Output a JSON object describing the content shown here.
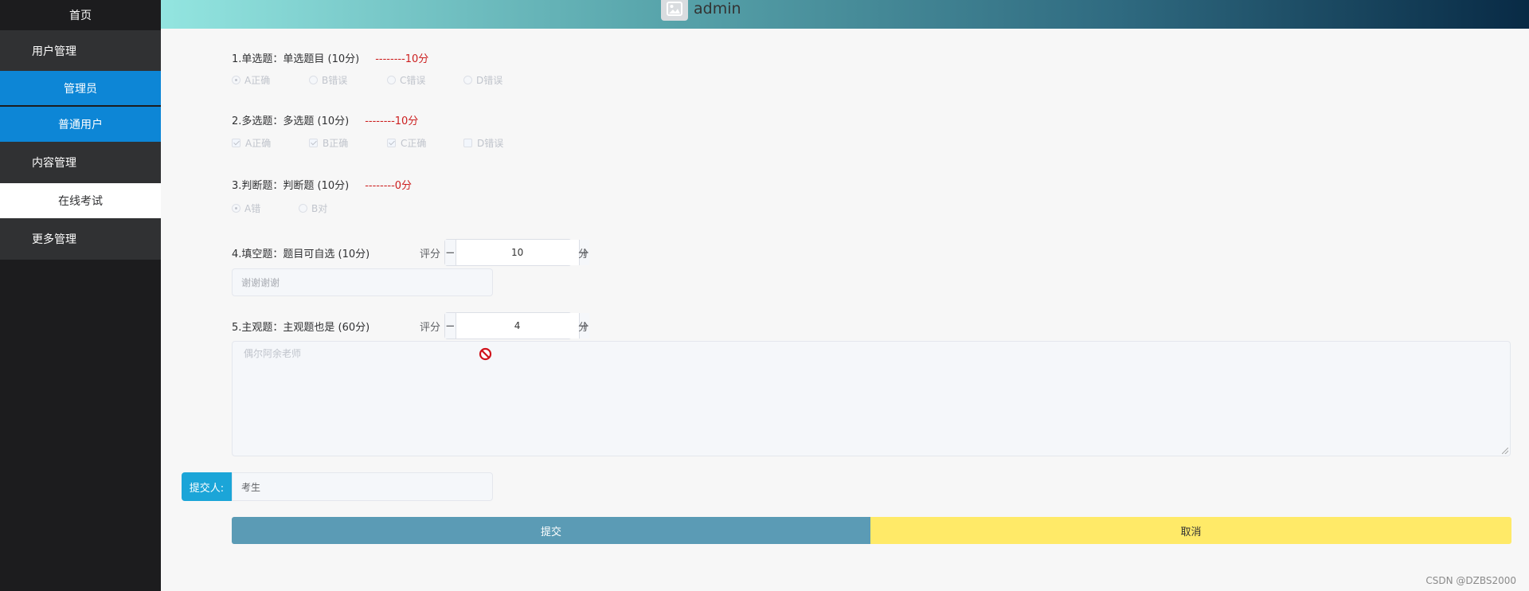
{
  "header": {
    "username": "admin"
  },
  "sidebar": {
    "home": "首页",
    "user_mgmt": "用户管理",
    "admin": "管理员",
    "normal_user": "普通用户",
    "content_mgmt": "内容管理",
    "online_exam": "在线考试",
    "more_mgmt": "更多管理"
  },
  "questions": [
    {
      "title": "1.单选题：单选题目 (10分)",
      "score": "--------10分",
      "options": [
        "A正确",
        "B错误",
        "C错误",
        "D错误"
      ]
    },
    {
      "title": "2.多选题：多选题 (10分)",
      "score": "--------10分",
      "options": [
        "A正确",
        "B正确",
        "C正确",
        "D错误"
      ]
    },
    {
      "title": "3.判断题：判断题 (10分)",
      "score": "--------0分",
      "options": [
        "A错",
        "B对"
      ]
    },
    {
      "title": "4.填空题：题目可自选 (10分)",
      "score_label": "评分",
      "score_value": "10",
      "unit": "分",
      "answer": "谢谢谢谢"
    },
    {
      "title": "5.主观题：主观题也是 (60分)",
      "score_label": "评分",
      "score_value": "4",
      "unit": "分",
      "answer": "偶尔阿余老师"
    }
  ],
  "submitter": {
    "label": "提交人:",
    "value": "考生"
  },
  "buttons": {
    "submit": "提交",
    "cancel": "取消"
  },
  "stepper": {
    "minus": "−",
    "plus": "+"
  },
  "watermark": "CSDN @DZBS2000",
  "colors": {
    "nav_active": "#0d86d6",
    "submit_btn": "#5b9bb5",
    "cancel_btn": "#ffea68",
    "score_red": "#cc1f1f",
    "prepend": "#1ba5d8"
  }
}
